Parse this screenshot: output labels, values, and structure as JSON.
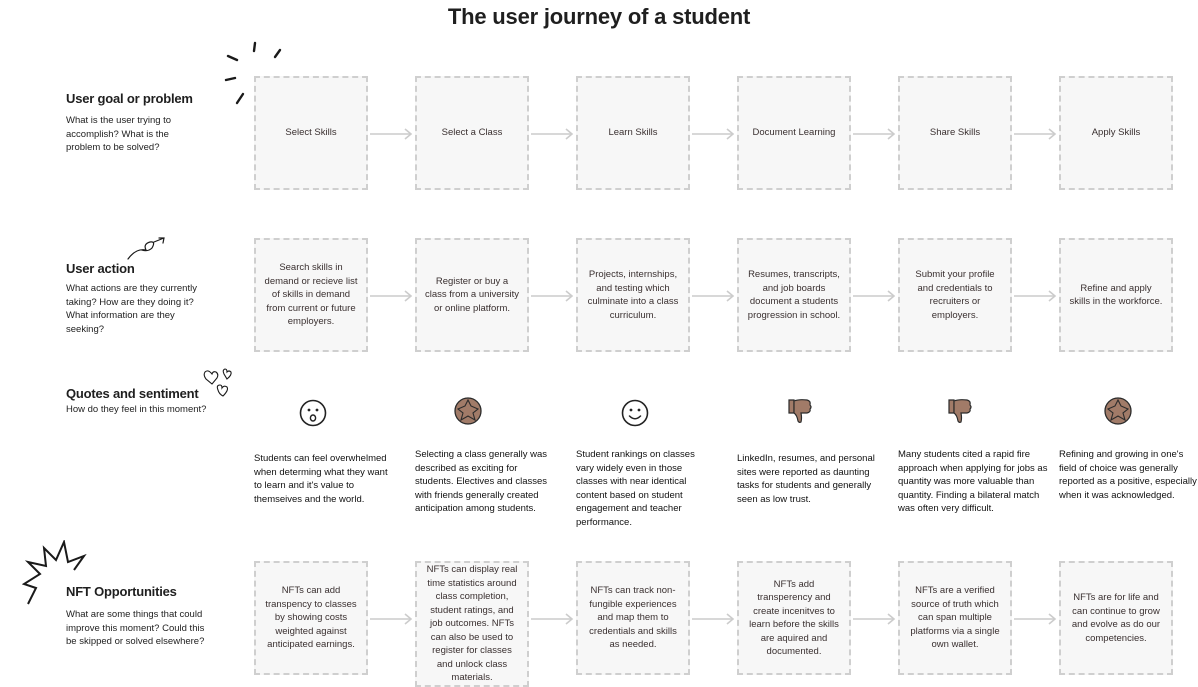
{
  "title": "The user journey of a student",
  "rows": {
    "goal": {
      "heading": "User goal or problem",
      "description": "What is the user trying to accomplish? What is the problem to be solved?",
      "cards": [
        "Select Skills",
        "Select a Class",
        "Learn Skills",
        "Document Learning",
        "Share Skills",
        "Apply Skills"
      ]
    },
    "action": {
      "heading": "User action",
      "description": "What actions are they currently taking? How are they doing it? What information are they seeking?",
      "cards": [
        "Search skills in demand or recieve list of skills in demand from current or future employers.",
        "Register or buy a class from a university or online platform.",
        "Projects, internships, and testing which culminate into a class curriculum.",
        "Resumes, transcripts, and job boards document a students progression in school.",
        "Submit your profile and credentials to recruiters or employers.",
        "Refine and apply skills in the workforce."
      ]
    },
    "quotes": {
      "heading": "Quotes and sentiment",
      "description": "How do they feel in this moment?",
      "sentiments": [
        "surprised-face-icon",
        "star-badge-icon",
        "smiling-face-icon",
        "thumbs-down-icon",
        "thumbs-down-icon",
        "star-badge-icon"
      ],
      "quotes": [
        "Students can feel overwhelmed when determing what they want to learn and it's value to themseives and the world.",
        "Selecting a class generally was described as exciting for students. Electives and classes with friends generally created anticipation among students.",
        "Student rankings on classes vary widely even in those classes with near identical content based on student engagement and teacher performance.",
        "LinkedIn, resumes, and personal sites were reported as daunting tasks for students and generally seen as low trust.",
        "Many students cited a rapid fire approach when applying for jobs as quantity was more valuable than quantity. Finding a bilateral match was often very difficult.",
        "Refining and growing in one's field of choice was generally reported as a positive, especially when it was acknowledged."
      ]
    },
    "nft": {
      "heading": "NFT Opportunities",
      "description": "What are some things that could improve this moment? Could this be skipped or solved elsewhere?",
      "cards": [
        "NFTs can add transpency to classes by showing costs weighted against anticipated earnings.",
        "NFTs can display real time statistics around class completion, student ratings, and job outcomes. NFTs can also be used to register for classes and unlock class materials.",
        "NFTs can track non-fungible experiences and map them to credentials and skills as needed.",
        "NFTs add transperency and create incenitves to learn before the skills are aquired and documented.",
        "NFTs are a verified source of truth which can span multiple platforms via a single own wallet.",
        "NFTs are for life and can continue to grow and evolve as do our competencies."
      ]
    }
  },
  "colors": {
    "card_border": "#cfcfcf",
    "card_fill": "#f7f7f7",
    "badge_brown": "#a17b68",
    "arrow": "#cccccc"
  }
}
